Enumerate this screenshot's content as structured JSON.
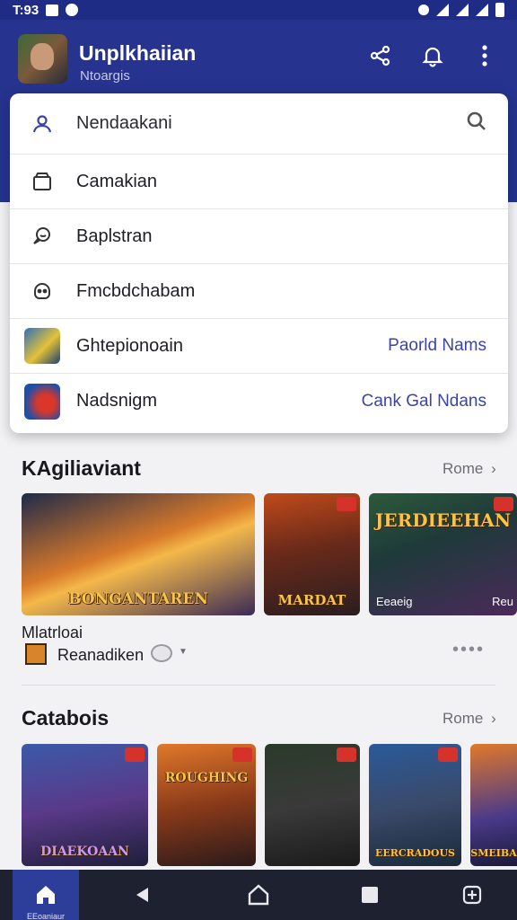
{
  "status_bar": {
    "time": "T:93"
  },
  "app_bar": {
    "title": "Unplkhaiian",
    "subtitle": "Ntoargis",
    "actions": [
      {
        "icon": "share-icon"
      },
      {
        "icon": "bell-icon"
      },
      {
        "icon": "more-vertical-icon"
      }
    ]
  },
  "menu": {
    "search": {
      "value": "Nendaakani",
      "icon": "user-icon",
      "action_icon": "search-icon"
    },
    "items": [
      {
        "label": "Camakian",
        "icon": "box-icon"
      },
      {
        "label": "Baplstran",
        "icon": "chat-icon"
      },
      {
        "label": "Fmcbdchabam",
        "icon": "face-icon"
      },
      {
        "label": "Ghtepionoain",
        "icon": "game-thumb-icon",
        "right": "Paorld Nams"
      },
      {
        "label": "Nadsnigm",
        "icon": "game-thumb-icon",
        "right": "Cank Gal Ndans"
      }
    ]
  },
  "section1": {
    "title": "KAgiliaviant",
    "more": "Rome",
    "cards": [
      {
        "caption": "BONGANTAREN"
      },
      {
        "caption": "MARDAT"
      },
      {
        "caption": "JERDIEEHAN",
        "footer_left": "Eeaeig",
        "footer_right": "Reu"
      }
    ],
    "feature_title": "Mlatrloai",
    "feature_author": "Reanadiken"
  },
  "section2": {
    "title": "Catabois",
    "more": "Rome",
    "cards": [
      {
        "caption": "DIAEKOAAN"
      },
      {
        "caption": "ROUGHING"
      },
      {
        "caption": ""
      },
      {
        "caption": "EERCRADOUS"
      },
      {
        "caption": "SMEIBA"
      }
    ]
  },
  "nav": {
    "active_label": "EEoaniaur"
  },
  "colors": {
    "primary": "#26338f",
    "accent_text": "#3b44a8",
    "nav_bg": "#1e2130"
  }
}
